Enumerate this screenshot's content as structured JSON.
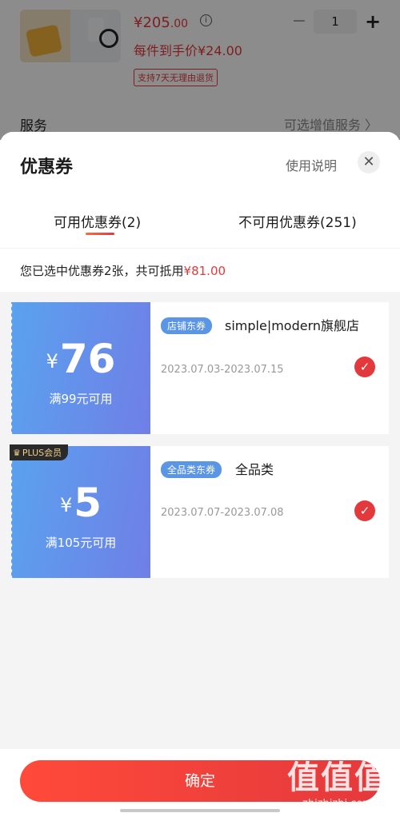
{
  "product": {
    "price_main": "¥205",
    "price_decimal": ".00",
    "info_icon": "info-icon",
    "final_price": "每件到手价¥24.00",
    "return_tag": "支持7天无理由退货",
    "quantity": "1",
    "qty_minus": "−",
    "qty_plus": "+"
  },
  "service": {
    "label": "服务",
    "value": "可选增值服务 〉"
  },
  "sheet": {
    "title": "优惠券",
    "usage_link": "使用说明",
    "close_icon": "✕",
    "tabs": [
      {
        "label": "可用优惠券(2)",
        "active": true
      },
      {
        "label": "不可用优惠券(251)",
        "active": false
      }
    ],
    "summary_prefix": "您已选中优惠券2张，共可抵用",
    "summary_amount": "¥81.00"
  },
  "coupons": [
    {
      "yen": "¥",
      "amount": "76",
      "condition": "满99元可用",
      "type": "店铺东券",
      "name": "simple|modern旗舰店",
      "date": "2023.07.03-2023.07.15",
      "selected": true
    },
    {
      "yen": "¥",
      "amount": "5",
      "condition": "满105元可用",
      "type": "全品类东券",
      "name": "全品类",
      "date": "2023.07.07-2023.07.08",
      "selected": true,
      "badge": "PLUS会员"
    }
  ],
  "footer": {
    "confirm": "确定"
  },
  "watermark": {
    "big": "值值值",
    "small": "zhizhizhi.com"
  },
  "colors": {
    "accent": "#e4393c",
    "coupon_blue": "#5aa2ef",
    "coupon_purple": "#6f7fe6"
  }
}
